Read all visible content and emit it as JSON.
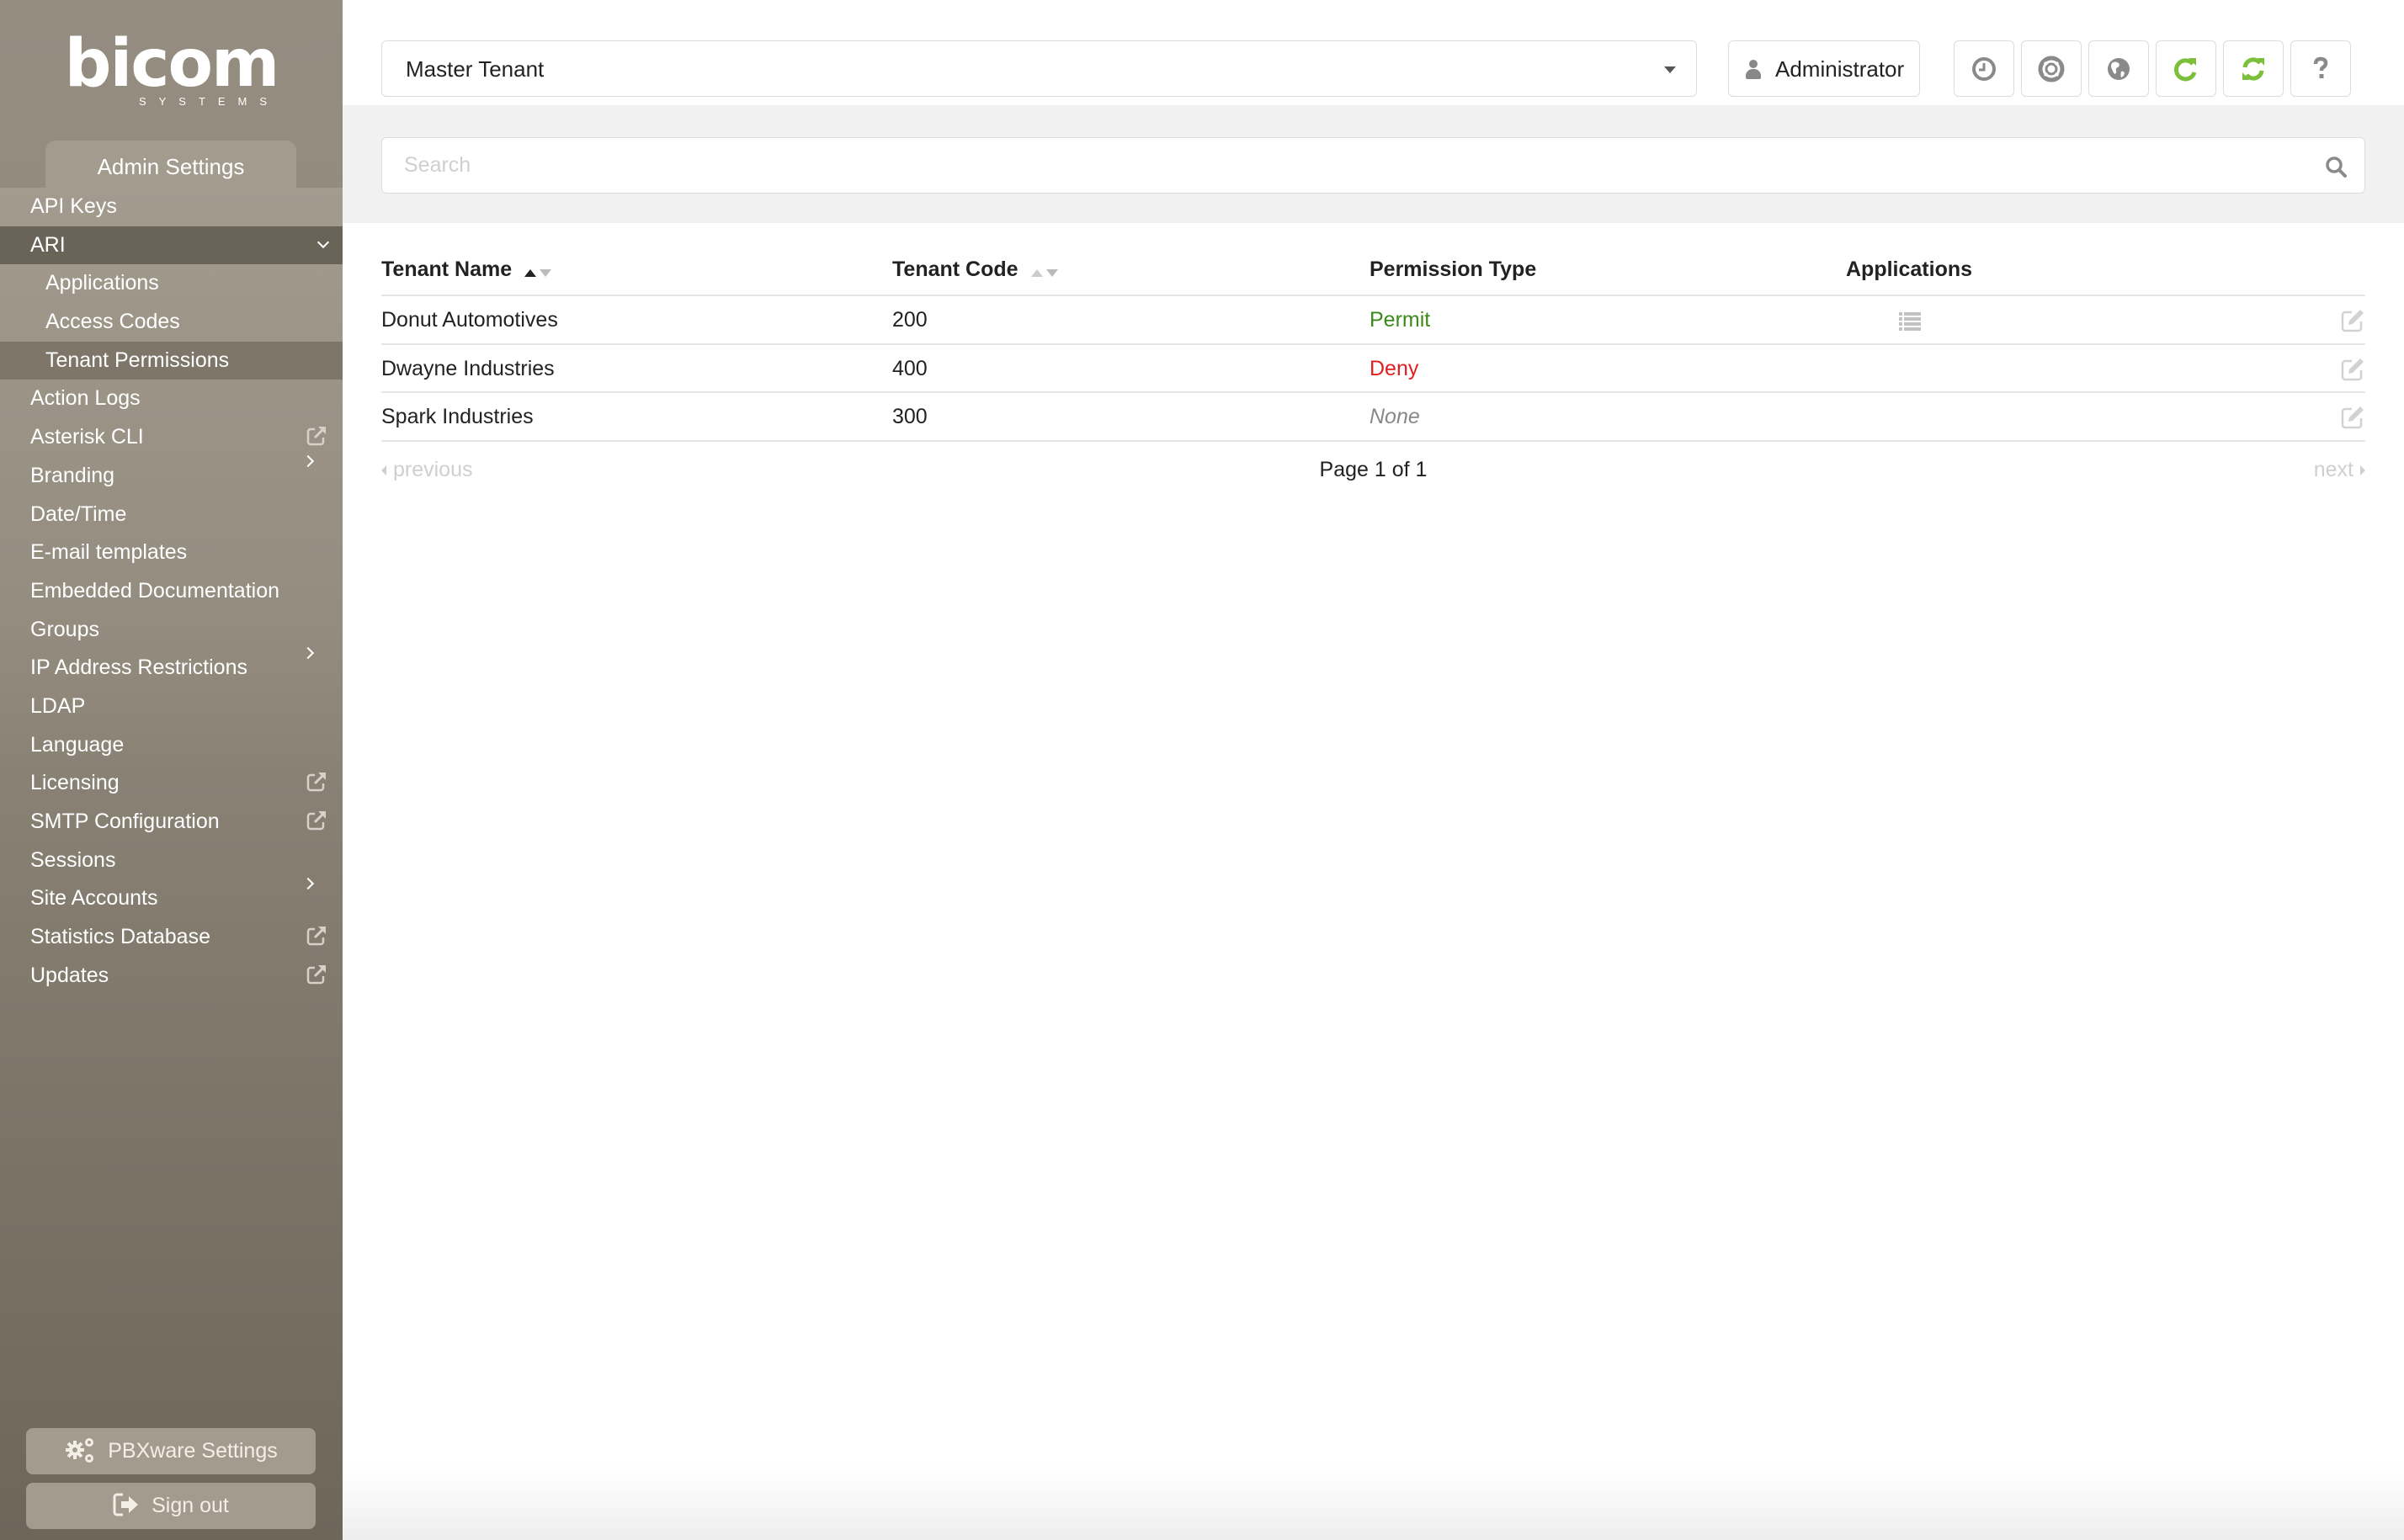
{
  "brand": {
    "logo_text": "bicom",
    "logo_subtext": "SYSTEMS"
  },
  "sidebar": {
    "section_tab": "Admin Settings",
    "items": [
      {
        "label": "API Keys",
        "level": 0,
        "indicator": "none",
        "state": ""
      },
      {
        "label": "ARI",
        "level": 0,
        "indicator": "chevron-down",
        "state": "expanded"
      },
      {
        "label": "Applications",
        "level": 1,
        "indicator": "none",
        "state": ""
      },
      {
        "label": "Access Codes",
        "level": 1,
        "indicator": "none",
        "state": ""
      },
      {
        "label": "Tenant Permissions",
        "level": 1,
        "indicator": "none",
        "state": "active"
      },
      {
        "label": "Action Logs",
        "level": 0,
        "indicator": "none",
        "state": ""
      },
      {
        "label": "Asterisk CLI",
        "level": 0,
        "indicator": "external-link",
        "state": ""
      },
      {
        "label": "Branding",
        "level": 0,
        "indicator": "chevron-right",
        "state": ""
      },
      {
        "label": "Date/Time",
        "level": 0,
        "indicator": "none",
        "state": ""
      },
      {
        "label": "E-mail templates",
        "level": 0,
        "indicator": "none",
        "state": ""
      },
      {
        "label": "Embedded Documentation",
        "level": 0,
        "indicator": "none",
        "state": ""
      },
      {
        "label": "Groups",
        "level": 0,
        "indicator": "none",
        "state": ""
      },
      {
        "label": "IP Address Restrictions",
        "level": 0,
        "indicator": "chevron-right",
        "state": ""
      },
      {
        "label": "LDAP",
        "level": 0,
        "indicator": "none",
        "state": ""
      },
      {
        "label": "Language",
        "level": 0,
        "indicator": "none",
        "state": ""
      },
      {
        "label": "Licensing",
        "level": 0,
        "indicator": "external-link",
        "state": ""
      },
      {
        "label": "SMTP Configuration",
        "level": 0,
        "indicator": "external-link",
        "state": ""
      },
      {
        "label": "Sessions",
        "level": 0,
        "indicator": "none",
        "state": ""
      },
      {
        "label": "Site Accounts",
        "level": 0,
        "indicator": "chevron-right",
        "state": ""
      },
      {
        "label": "Statistics Database",
        "level": 0,
        "indicator": "external-link",
        "state": ""
      },
      {
        "label": "Updates",
        "level": 0,
        "indicator": "external-link",
        "state": ""
      }
    ],
    "pbxware_settings_label": "PBXware Settings",
    "sign_out_label": "Sign out"
  },
  "topbar": {
    "tenant_select": {
      "value": "Master Tenant"
    },
    "user_button": {
      "label": "Administrator",
      "icon": "user-icon"
    },
    "icon_buttons": [
      {
        "name": "clock",
        "icon": "clock-icon",
        "color": "#8a8a8a"
      },
      {
        "name": "support",
        "icon": "life-ring-icon",
        "color": "#8a8a8a"
      },
      {
        "name": "language",
        "icon": "globe-icon",
        "color": "#8a8a8a"
      },
      {
        "name": "reload",
        "icon": "rotate-right-icon",
        "color": "#7cbf3b"
      },
      {
        "name": "sync",
        "icon": "refresh-icon",
        "color": "#7cbf3b"
      },
      {
        "name": "help",
        "icon": "question-icon",
        "color": "#8a8a8a"
      }
    ]
  },
  "search": {
    "placeholder": "Search",
    "value": ""
  },
  "table": {
    "columns": [
      {
        "label": "Tenant Name",
        "sort": "asc"
      },
      {
        "label": "Tenant Code",
        "sort": "none"
      },
      {
        "label": "Permission Type",
        "sort": null
      },
      {
        "label": "Applications",
        "sort": null
      }
    ],
    "rows": [
      {
        "tenant_name": "Donut Automotives",
        "tenant_code": "200",
        "permission_type": "Permit",
        "permission_status": "permit",
        "has_applications": true
      },
      {
        "tenant_name": "Dwayne Industries",
        "tenant_code": "400",
        "permission_type": "Deny",
        "permission_status": "deny",
        "has_applications": false
      },
      {
        "tenant_name": "Spark Industries",
        "tenant_code": "300",
        "permission_type": "None",
        "permission_status": "none",
        "has_applications": false
      }
    ]
  },
  "pagination": {
    "previous_label": "previous",
    "next_label": "next",
    "page_text": "Page 1 of 1",
    "current_page": 1,
    "total_pages": 1
  },
  "colors": {
    "permit": "#3b8a1a",
    "deny": "#e02020",
    "none": "#888888",
    "accent_green": "#7cbf3b",
    "sidebar": "#958d80"
  }
}
